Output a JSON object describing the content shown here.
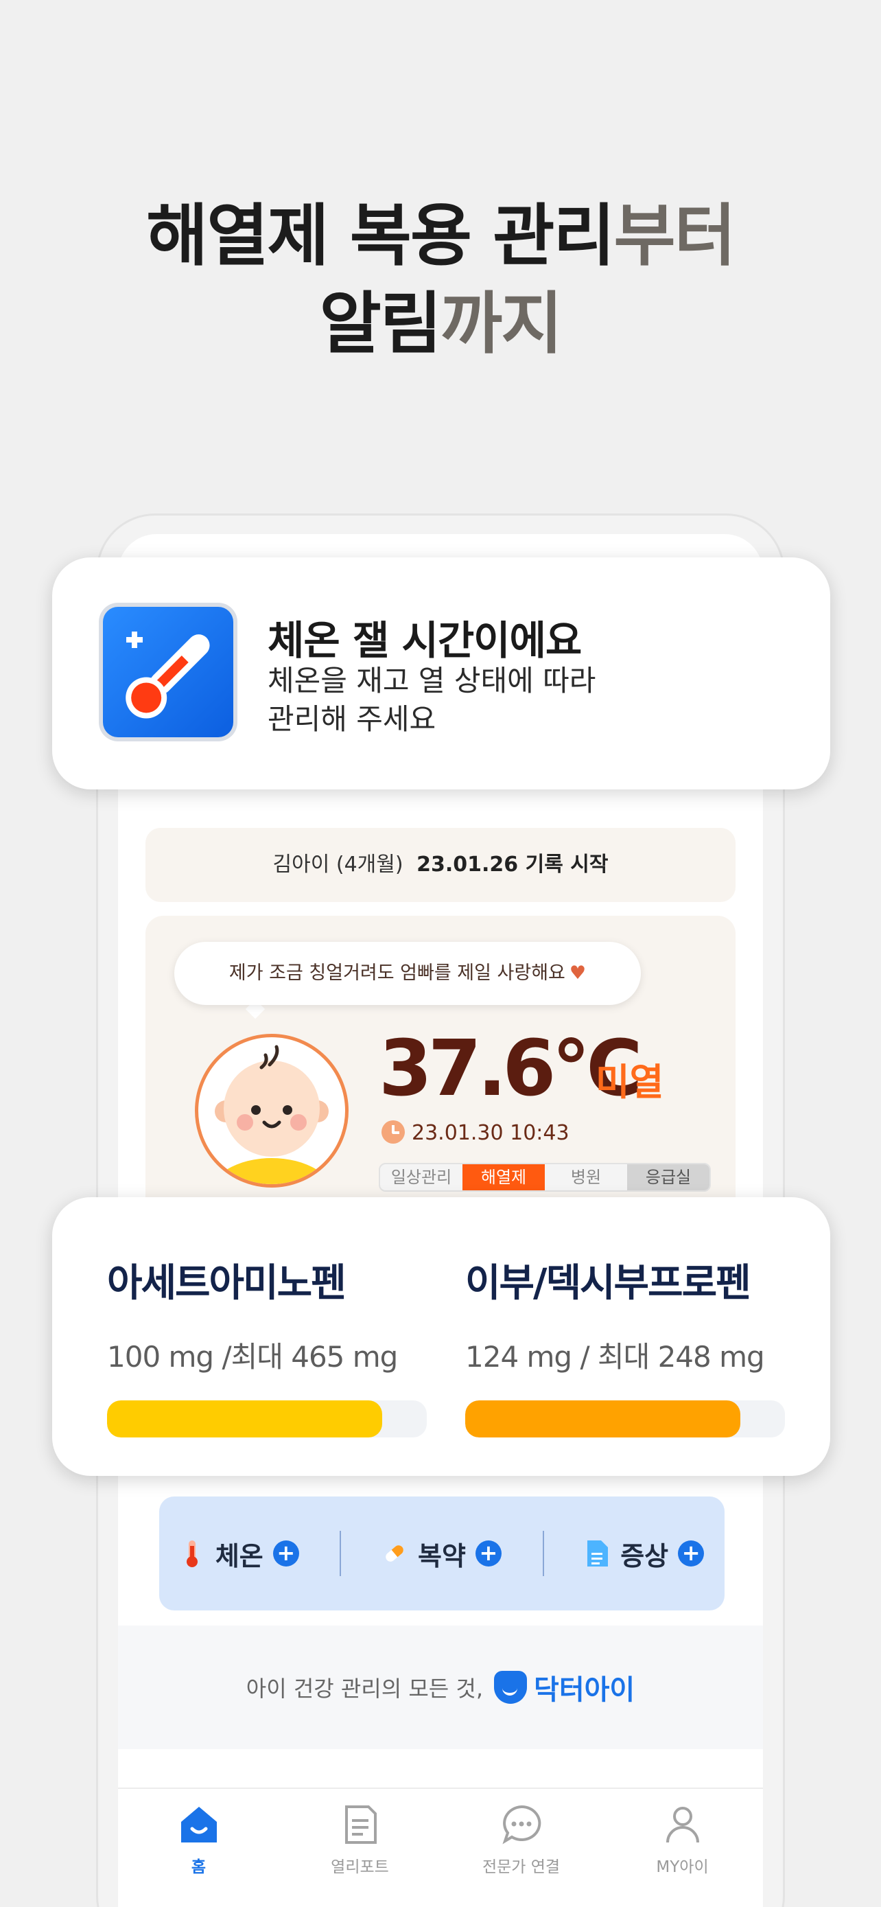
{
  "headline": {
    "line1_main": "해열제 복용 관리",
    "line1_accent": "부터",
    "line2_main": "알림",
    "line2_accent": "까지"
  },
  "notification": {
    "icon": "thermometer-icon",
    "title": "체온 잴 시간이에요",
    "body_line1": "체온을 재고 열 상태에 따라",
    "body_line2": "관리해 주세요"
  },
  "child_info": {
    "name": "김아이",
    "age": "(4개월)",
    "record_start": "23.01.26 기록 시작"
  },
  "status_card": {
    "bubble_text": "제가 조금 칭얼거려도 엄빠를 제일 사랑해요",
    "bubble_icon": "heart-icon",
    "temperature": "37.6°C",
    "temp_status": "미열",
    "timestamp": "23.01.30 10:43",
    "care_levels": [
      "일상관리",
      "해열제",
      "병원",
      "응급실"
    ],
    "active_level": "해열제",
    "colors": {
      "temperature": "#5b1d10",
      "status": "#ff6a1a"
    }
  },
  "medications": [
    {
      "name": "아세트아미노펜",
      "dose": "100 mg /최대 465 mg",
      "fill": 0.86,
      "color": "#ffcc00"
    },
    {
      "name": "이부/덱시부프로펜",
      "dose": "124 mg / 최대 248 mg",
      "fill": 0.86,
      "color": "#ffa200"
    }
  ],
  "quick_actions": [
    {
      "label": "체온",
      "icon": "thermometer-icon"
    },
    {
      "label": "복약",
      "icon": "pill-icon"
    },
    {
      "label": "증상",
      "icon": "document-icon"
    }
  ],
  "brand": {
    "tagline": "아이 건강 관리의 모든 것,",
    "name": "닥터아이"
  },
  "tabs": [
    {
      "label": "홈",
      "icon": "home-icon",
      "active": true
    },
    {
      "label": "열리포트",
      "icon": "report-icon",
      "active": false
    },
    {
      "label": "전문가 연결",
      "icon": "chat-icon",
      "active": false
    },
    {
      "label": "MY아이",
      "icon": "profile-icon",
      "active": false
    }
  ]
}
